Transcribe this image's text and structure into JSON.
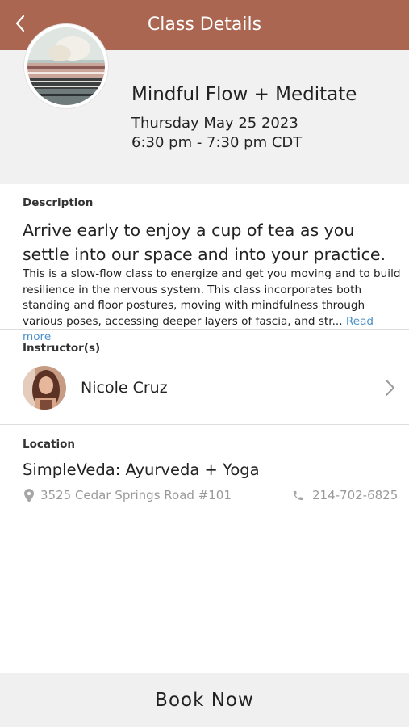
{
  "header": {
    "title": "Class Details",
    "back_icon": "chevron-left-icon"
  },
  "class_info": {
    "name": "Mindful Flow + Meditate",
    "date": "Thursday May 25 2023",
    "time": "6:30 pm - 7:30 pm CDT"
  },
  "description": {
    "label": "Description",
    "headline": "Arrive early to enjoy a cup of tea as you settle into our space and into your practice.",
    "body": "This is a slow-flow class to energize and get you moving and to build resilience in the nervous system. This class incorporates both standing and floor postures, moving with mindfulness through various poses, accessing deeper layers of fascia, and str...",
    "read_more": "Read more"
  },
  "instructor": {
    "label": "Instructor(s)",
    "name": "Nicole Cruz"
  },
  "location": {
    "label": "Location",
    "name": "SimpleVeda: Ayurveda + Yoga",
    "address": "3525 Cedar Springs Road #101",
    "phone": "214-702-6825"
  },
  "footer": {
    "book_label": "Book Now"
  },
  "colors": {
    "header_bg": "#ab6651",
    "link": "#4a90c9",
    "panel_bg": "#f1f1f1"
  }
}
